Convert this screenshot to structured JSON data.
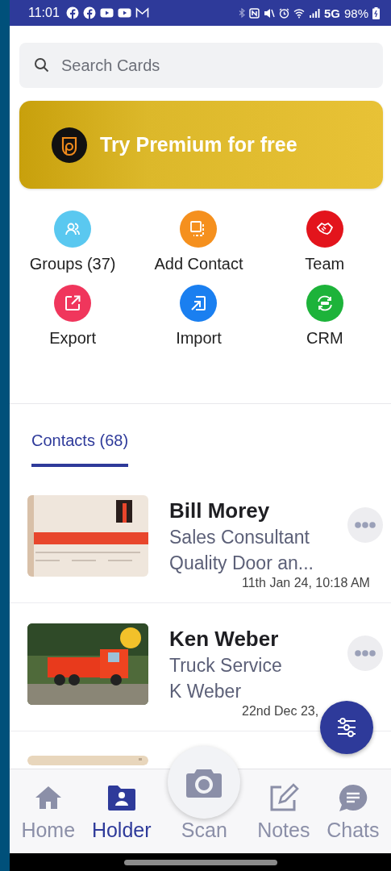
{
  "status_bar": {
    "time": "11:01",
    "network": "5G",
    "battery": "98%"
  },
  "search": {
    "placeholder": "Search Cards"
  },
  "banner": {
    "text": "Try Premium for free"
  },
  "actions": [
    {
      "label": "Groups (37)",
      "kind": "groups",
      "color": "#5ac8f0"
    },
    {
      "label": "Add Contact",
      "kind": "add",
      "color": "#f5901e"
    },
    {
      "label": "Team",
      "kind": "team",
      "color": "#e3141c"
    },
    {
      "label": "Export",
      "kind": "export",
      "color": "#f0365c"
    },
    {
      "label": "Import",
      "kind": "import",
      "color": "#1a7ff0"
    },
    {
      "label": "CRM",
      "kind": "crm",
      "color": "#1db33a"
    }
  ],
  "tabs": [
    {
      "label": "Contacts (68)",
      "selected": true
    }
  ],
  "contacts": [
    {
      "name": "Bill Morey",
      "title": "Sales Consultant",
      "company": "Quality Door an...",
      "date": "11th Jan 24, 10:18 AM"
    },
    {
      "name": "Ken Weber",
      "title": "Truck Service",
      "company": "K Weber",
      "date": "22nd Dec 23,"
    }
  ],
  "nav": [
    {
      "label": "Home",
      "kind": "home",
      "selected": false
    },
    {
      "label": "Holder",
      "kind": "holder",
      "selected": true
    },
    {
      "label": "Scan",
      "kind": "scan",
      "selected": false
    },
    {
      "label": "Notes",
      "kind": "notes",
      "selected": false
    },
    {
      "label": "Chats",
      "kind": "chats",
      "selected": false
    }
  ]
}
